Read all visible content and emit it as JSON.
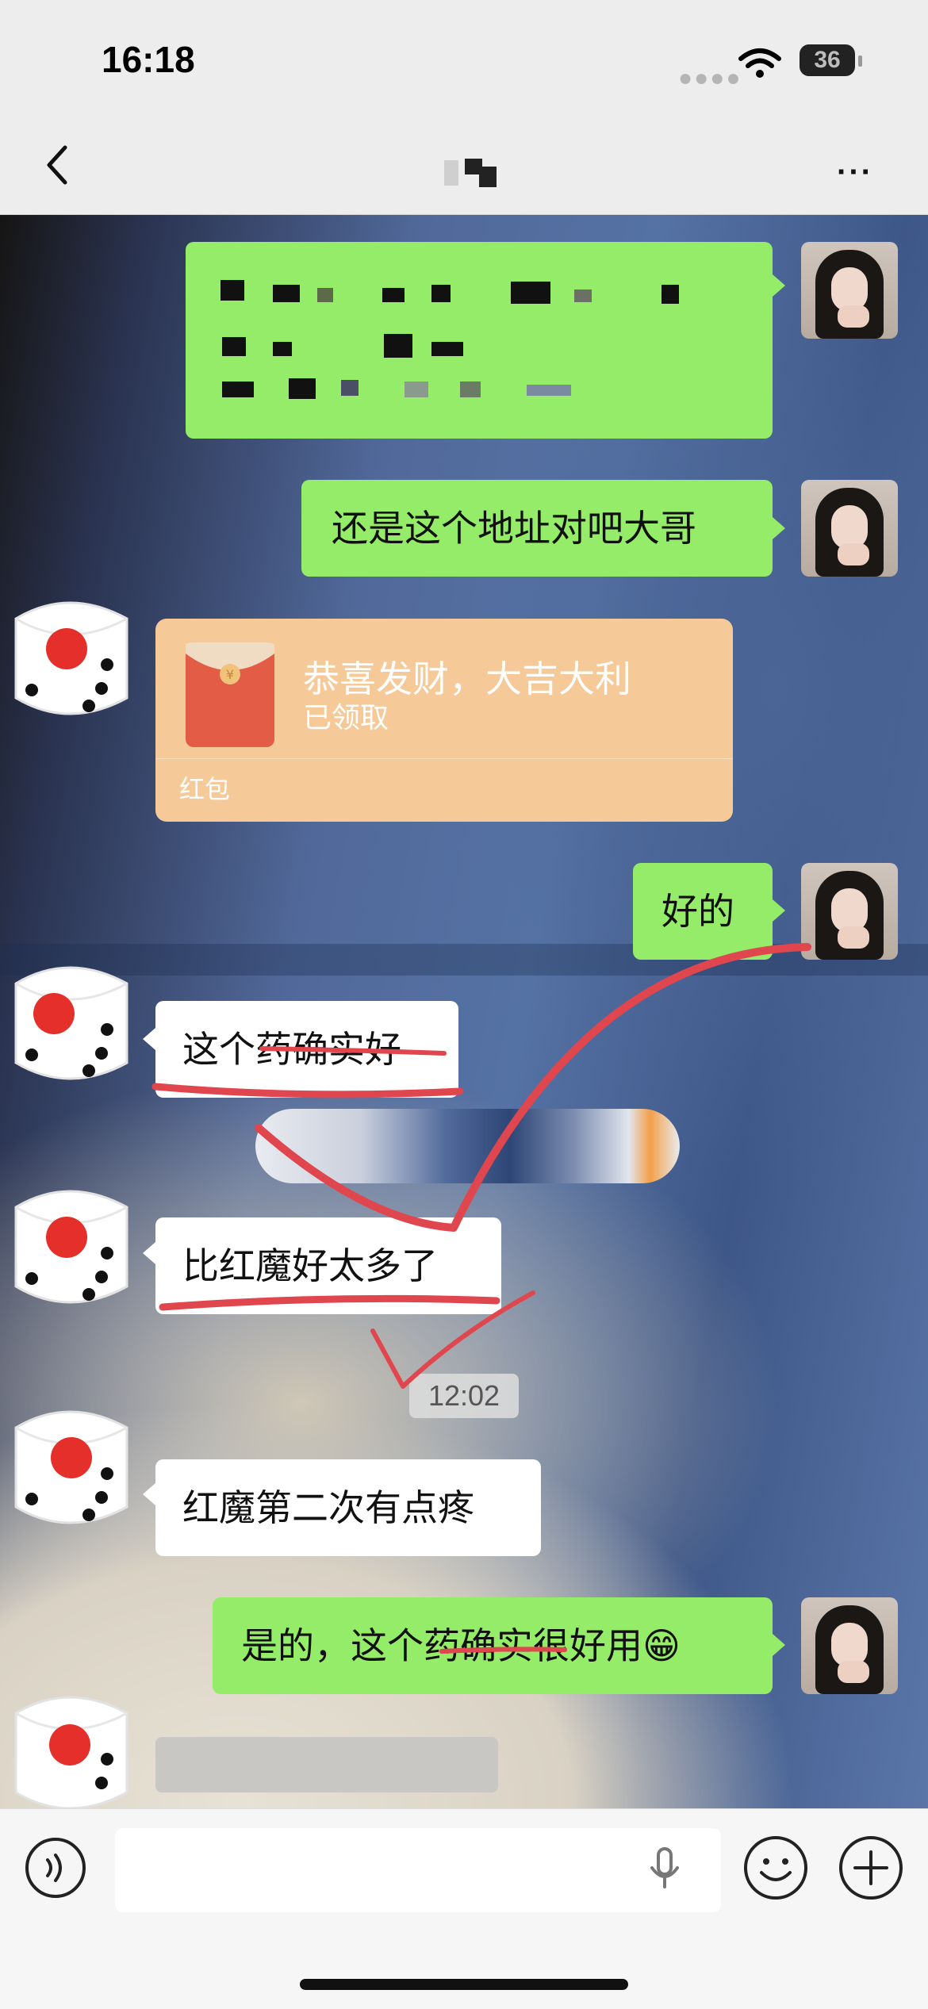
{
  "status": {
    "time": "16:18",
    "battery": "36"
  },
  "nav": {
    "back_icon": "chevron-left-icon",
    "more": "···"
  },
  "messages": {
    "m2": "还是这个地址对吧大哥",
    "m4": "好的",
    "m5": "这个药确实好",
    "m6": "比红魔好太多了",
    "m7": "红魔第二次有点疼",
    "m8_prefix": "是的，这个",
    "m8_strike": "药确实",
    "m8_suffix": "很好用",
    "m8_emoji": "😁"
  },
  "red_packet": {
    "title": "恭喜发财，大吉大利",
    "status": "已领取",
    "label": "红包"
  },
  "timestamp": "12:02",
  "input": {
    "placeholder": ""
  },
  "colors": {
    "sent_bubble": "#95ec69",
    "received_bubble": "#ffffff",
    "red_packet": "#f6c998",
    "annotation_red": "#e0464e"
  }
}
